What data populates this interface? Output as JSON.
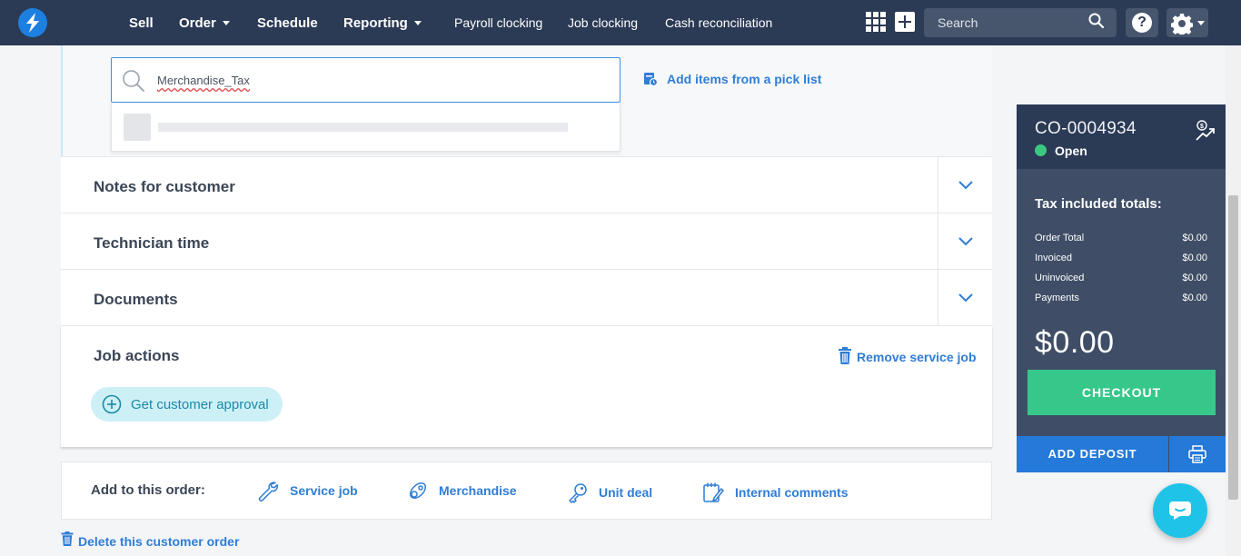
{
  "nav": {
    "items": [
      {
        "label": "Sell"
      },
      {
        "label": "Order"
      },
      {
        "label": "Schedule"
      },
      {
        "label": "Reporting"
      },
      {
        "label": "Payroll clocking"
      },
      {
        "label": "Job clocking"
      },
      {
        "label": "Cash reconciliation"
      }
    ],
    "search_placeholder": "Search",
    "help_glyph": "?",
    "icons": [
      "bolt-logo-icon",
      "apps-grid-icon",
      "plus-icon",
      "search-icon",
      "help-icon",
      "gear-icon"
    ]
  },
  "item_search": {
    "value": "Merchandise_Tax"
  },
  "picklist": {
    "label": "Add items from a pick list"
  },
  "sections": [
    {
      "title": "Notes for customer"
    },
    {
      "title": "Technician time"
    },
    {
      "title": "Documents"
    }
  ],
  "job_actions": {
    "title": "Job actions",
    "remove_label": "Remove service job",
    "approval_label": "Get customer approval"
  },
  "add_bar": {
    "title": "Add to this order:",
    "links": [
      {
        "label": "Service job"
      },
      {
        "label": "Merchandise"
      },
      {
        "label": "Unit deal"
      },
      {
        "label": "Internal comments"
      }
    ]
  },
  "delete_label": "Delete this customer order",
  "order": {
    "id": "CO-0004934",
    "status": "Open",
    "status_color": "#3cc882",
    "totals_title": "Tax included totals:",
    "rows": [
      {
        "label": "Order Total",
        "value": "$0.00"
      },
      {
        "label": "Invoiced",
        "value": "$0.00"
      },
      {
        "label": "Uninvoiced",
        "value": "$0.00"
      },
      {
        "label": "Payments",
        "value": "$0.00"
      }
    ],
    "total": "$0.00",
    "checkout_label": "CHECKOUT",
    "deposit_label": "ADD DEPOSIT"
  },
  "colors": {
    "nav_bg": "#2b3a55",
    "accent": "#2f7dd7",
    "checkout": "#36c88a",
    "chat": "#1fc3e8"
  }
}
